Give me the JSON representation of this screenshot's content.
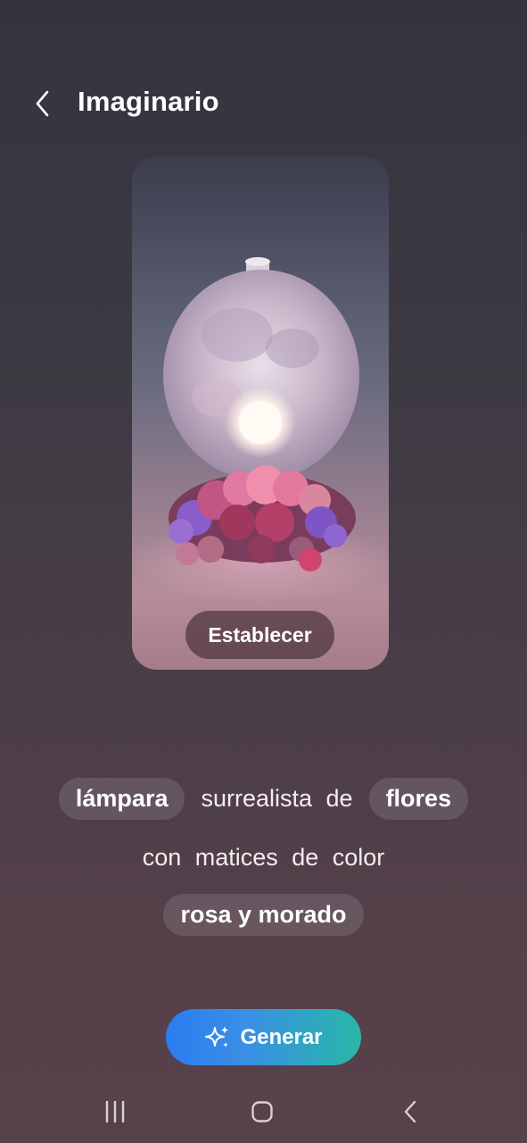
{
  "header": {
    "title": "Imaginario",
    "back_icon": "chevron-left-icon"
  },
  "image_card": {
    "set_label": "Establecer"
  },
  "prompt": {
    "line1": {
      "chip1": "lámpara",
      "text": "surrealista de",
      "chip2": "flores"
    },
    "line2": {
      "text": "con matices de color"
    },
    "line3": {
      "chip": "rosa y morado"
    }
  },
  "generate": {
    "label": "Generar",
    "icon": "sparkle-icon",
    "gradient": [
      "#2b7cf0",
      "#29b7a6"
    ]
  },
  "navbar": {
    "recents_icon": "recents-icon",
    "home_icon": "home-icon",
    "back_icon": "back-icon"
  }
}
